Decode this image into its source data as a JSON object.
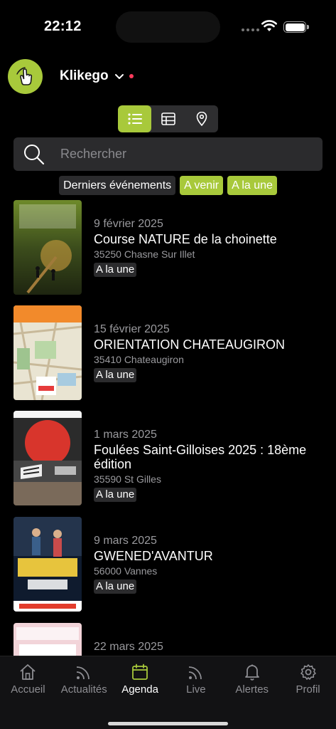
{
  "status_bar": {
    "time": "22:12"
  },
  "header": {
    "account_name": "Klikego"
  },
  "search": {
    "placeholder": "Rechercher"
  },
  "filters": [
    {
      "label": "Derniers événements",
      "active": false
    },
    {
      "label": "A venir",
      "active": true
    },
    {
      "label": "A la une",
      "active": true
    }
  ],
  "events": [
    {
      "date": "9 février 2025",
      "title": "Course NATURE de la choinette",
      "city": "35250 Chasne Sur Illet",
      "badge": "A la une"
    },
    {
      "date": "15 février 2025",
      "title": "ORIENTATION CHATEAUGIRON",
      "city": "35410 Chateaugiron",
      "badge": "A la une"
    },
    {
      "date": "1 mars 2025",
      "title": "Foulées Saint-Gilloises 2025 : 18ème édition",
      "city": "35590 St Gilles",
      "badge": "A la une"
    },
    {
      "date": "9 mars 2025",
      "title": "GWENED'AVANTUR",
      "city": "56000 Vannes",
      "badge": "A la une"
    },
    {
      "date": "22 mars 2025",
      "title": "",
      "city": "",
      "badge": ""
    }
  ],
  "tabs": [
    {
      "label": "Accueil",
      "icon": "home-icon"
    },
    {
      "label": "Actualités",
      "icon": "rss-icon"
    },
    {
      "label": "Agenda",
      "icon": "calendar-icon"
    },
    {
      "label": "Live",
      "icon": "live-icon"
    },
    {
      "label": "Alertes",
      "icon": "bell-icon"
    },
    {
      "label": "Profil",
      "icon": "gear-icon"
    }
  ],
  "active_tab": "Agenda",
  "colors": {
    "accent": "#a8c93b",
    "surface": "#2b2b2d",
    "background": "#000000",
    "notification_dot": "#ff3b5c"
  }
}
